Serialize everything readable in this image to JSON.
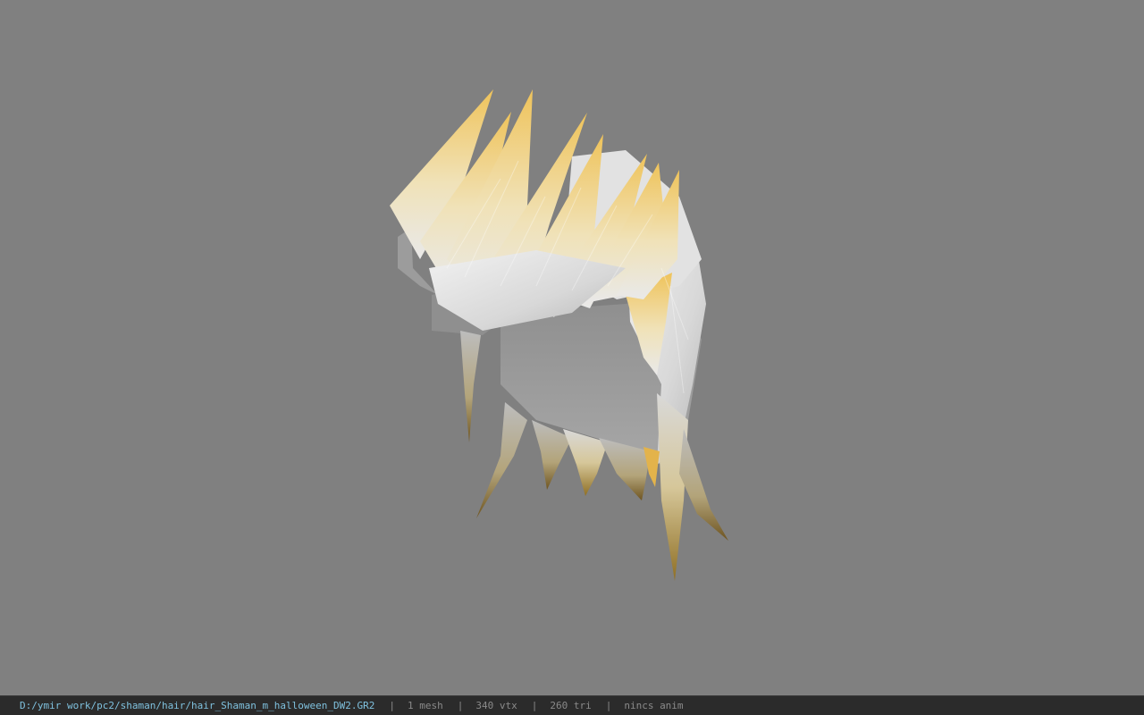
{
  "viewer": {
    "background_color": "#808080",
    "model": {
      "subject": "hair-mesh",
      "colors": {
        "white": "#e6e6e6",
        "shadow": "#9a9a9a",
        "tip_yellow": "#e8bf57",
        "tip_dark": "#7a6025"
      }
    }
  },
  "status_bar": {
    "path": "D:/ymir work/pc2/shaman/hair/hair_Shaman_m_halloween_DW2.GR2",
    "separator": "|",
    "mesh_count": "1 mesh",
    "vertex_count": "340 vtx",
    "triangle_count": "260 tri",
    "animation": "nincs anim",
    "path_color": "#7fc1de",
    "text_color": "#8a8a8a"
  }
}
